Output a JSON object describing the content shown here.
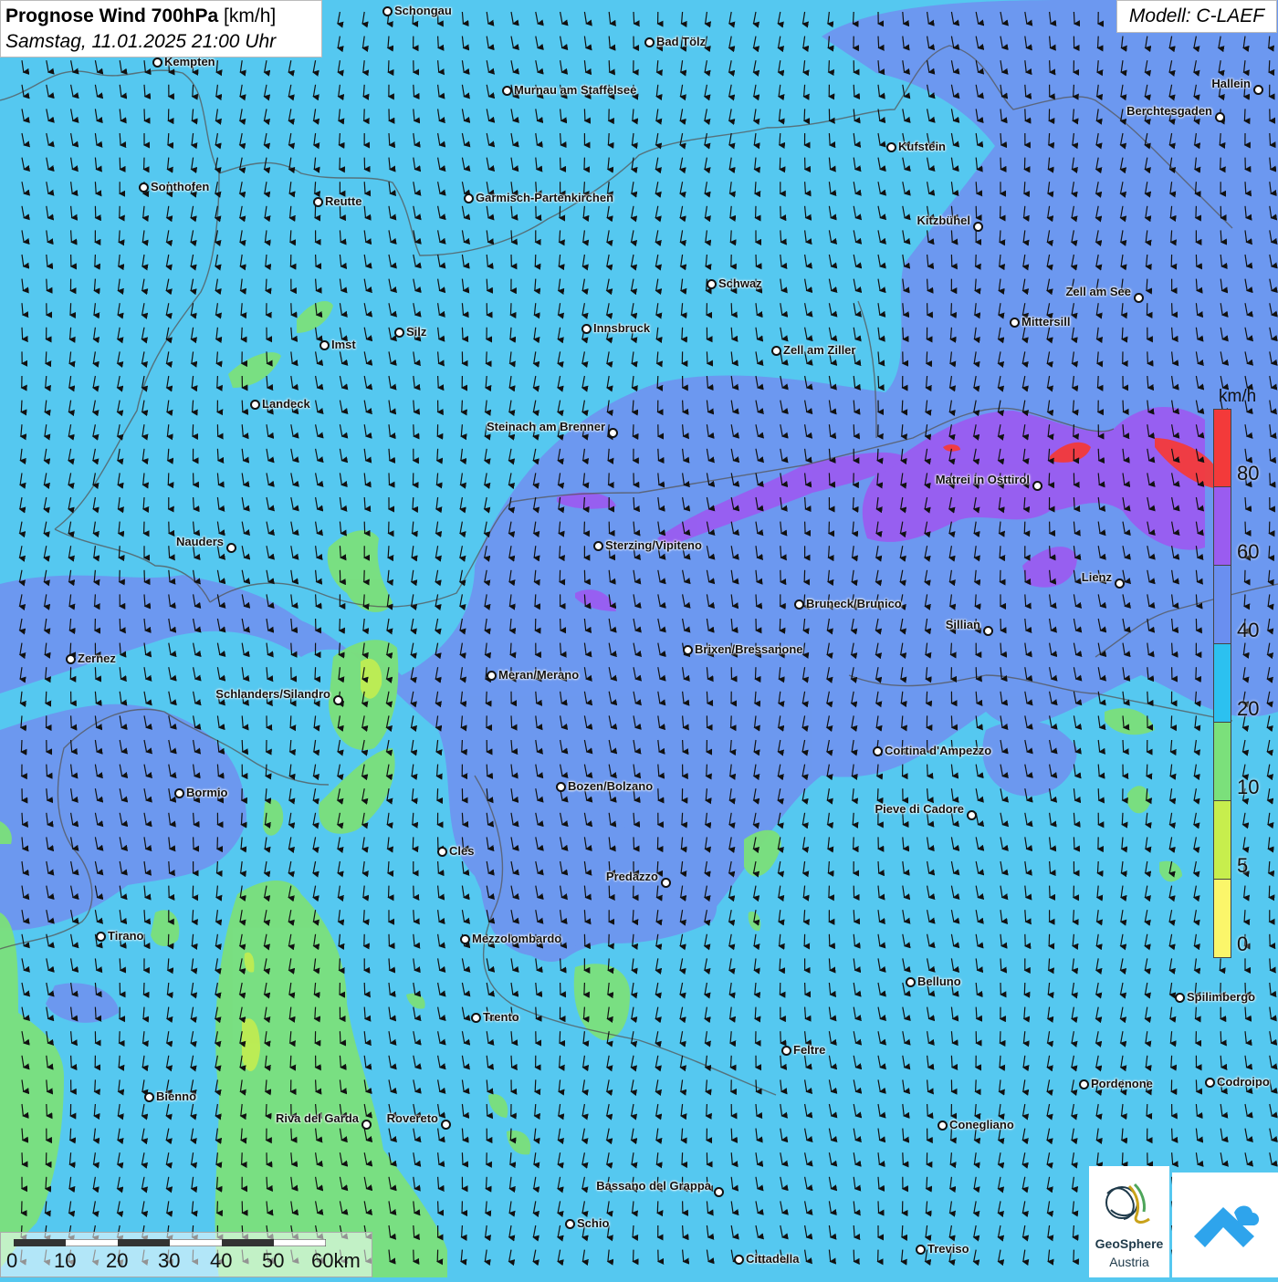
{
  "header": {
    "title_bold": "Prognose Wind 700hPa",
    "title_unit": "[km/h]",
    "subtitle": "Samstag, 11.01.2025 21:00 Uhr",
    "model": "Modell: C-LAEF"
  },
  "legend": {
    "unit": "km/h",
    "labels": [
      "80",
      "60",
      "40",
      "20",
      "10",
      "5",
      "0"
    ],
    "colors": [
      "#f33a3a",
      "#9a5cf0",
      "#6a8ff0",
      "#2cc1f0",
      "#7be07b",
      "#c7ee4d",
      "#fbf66a"
    ]
  },
  "scalebar": {
    "labels": [
      "0",
      "10",
      "20",
      "30",
      "40",
      "50",
      "60km"
    ]
  },
  "logo": {
    "name": "GeoSphere",
    "sub": "Austria",
    "icon": "geosphere-logo-icon",
    "app_icon": "weather-app-icon"
  },
  "cities": [
    {
      "name": "Schongau"
    },
    {
      "name": "Bad Tölz"
    },
    {
      "name": "Kempten"
    },
    {
      "name": "Murnau am Staffelsee"
    },
    {
      "name": "Hallein"
    },
    {
      "name": "Berchtesgaden"
    },
    {
      "name": "Kufstein"
    },
    {
      "name": "Sonthofen"
    },
    {
      "name": "Reutte"
    },
    {
      "name": "Garmisch-Partenkirchen"
    },
    {
      "name": "Kitzbühel"
    },
    {
      "name": "Schwaz"
    },
    {
      "name": "Zell am See"
    },
    {
      "name": "Mittersill"
    },
    {
      "name": "Innsbruck"
    },
    {
      "name": "Silz"
    },
    {
      "name": "Imst"
    },
    {
      "name": "Zell am Ziller"
    },
    {
      "name": "Landeck"
    },
    {
      "name": "Steinach am Brenner"
    },
    {
      "name": "Matrei in Osttirol"
    },
    {
      "name": "Nauders"
    },
    {
      "name": "Sterzing/Vipiteno"
    },
    {
      "name": "Lienz"
    },
    {
      "name": "Bruneck/Brunico"
    },
    {
      "name": "Sillian"
    },
    {
      "name": "Brixen/Bressanone"
    },
    {
      "name": "Zernez"
    },
    {
      "name": "Meran/Merano"
    },
    {
      "name": "Schlanders/Silandro"
    },
    {
      "name": "Cortina d'Ampezzo"
    },
    {
      "name": "Bozen/Bolzano"
    },
    {
      "name": "Bormio"
    },
    {
      "name": "Pieve di Cadore"
    },
    {
      "name": "Cles"
    },
    {
      "name": "Predazzo"
    },
    {
      "name": "Tirano"
    },
    {
      "name": "Mezzolombardo"
    },
    {
      "name": "Belluno"
    },
    {
      "name": "Spilimbergo"
    },
    {
      "name": "Trento"
    },
    {
      "name": "Feltre"
    },
    {
      "name": "Pordenone"
    },
    {
      "name": "Codroipo"
    },
    {
      "name": "Bienno"
    },
    {
      "name": "Riva del Garda"
    },
    {
      "name": "Rovereto"
    },
    {
      "name": "Conegliano"
    },
    {
      "name": "Bassano del Grappa"
    },
    {
      "name": "Schio"
    },
    {
      "name": "Treviso"
    },
    {
      "name": "Cittadella"
    }
  ]
}
